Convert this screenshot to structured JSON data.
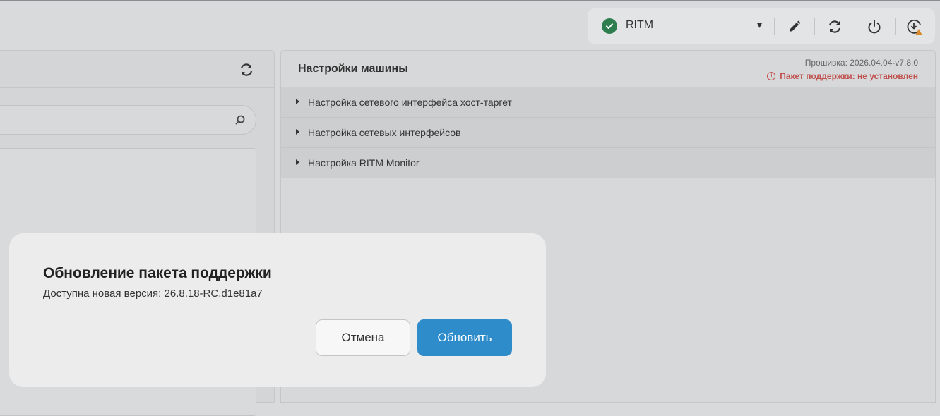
{
  "toolbar": {
    "machine_name": "RITM",
    "status_color": "#2e7d4f",
    "dropdown_glyph": "▾",
    "icons": [
      "check-circle-icon",
      "pencil-icon",
      "refresh-icon",
      "power-icon",
      "download-warning-icon"
    ]
  },
  "right_panel": {
    "title": "Настройки машины",
    "firmware": "Прошивка: 2026.04.04-v7.8.0",
    "support_warning": "Пакет поддержки: не установлен",
    "warning_color": "#c0504d",
    "sections": [
      {
        "label": "Настройка сетевого интерфейса хост-таргет"
      },
      {
        "label": "Настройка сетевых интерфейсов"
      },
      {
        "label": "Настройка RITM Monitor"
      }
    ]
  },
  "dialog": {
    "title": "Обновление пакета поддержки",
    "message": "Доступна новая версия: 26.8.18-RC.d1e81a7",
    "cancel_label": "Отмена",
    "confirm_label": "Обновить",
    "accent": "#2e8ccb"
  }
}
